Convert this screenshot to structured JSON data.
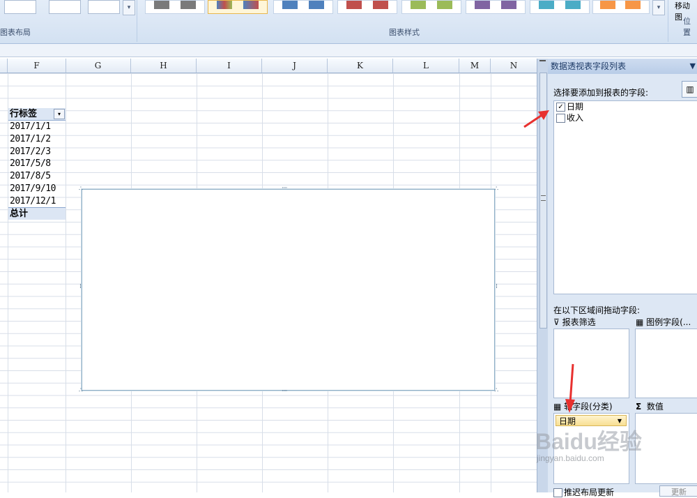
{
  "ribbon": {
    "group_chart_layout": "图表布局",
    "group_chart_styles": "图表样式",
    "group_location": "位置",
    "move_chart": "移动图"
  },
  "columns": [
    "F",
    "G",
    "H",
    "I",
    "J",
    "K",
    "L",
    "M",
    "N"
  ],
  "pivot": {
    "header": "行标签",
    "rows": [
      "2017/1/1",
      "2017/1/2",
      "2017/2/3",
      "2017/5/8",
      "2017/8/5",
      "2017/9/10",
      "2017/12/1"
    ],
    "total": "总计"
  },
  "panel": {
    "title": "数据透视表字段列表",
    "choose_fields": "选择要添加到报表的字段:",
    "fields": [
      {
        "label": "日期",
        "checked": true
      },
      {
        "label": "收入",
        "checked": false
      }
    ],
    "drag_label": "在以下区域间拖动字段:",
    "report_filter": "报表筛选",
    "legend_fields": "图例字段(...",
    "axis_fields": "轴字段(分类)",
    "values": "数值",
    "axis_item": "日期",
    "defer_update": "推迟布局更新",
    "update_button": "更新"
  },
  "watermark": {
    "logo": "Baidu经验",
    "url": "jingyan.baidu.com"
  },
  "colors": {
    "arrow": "#e8312f",
    "accent": "#dce6f4"
  }
}
